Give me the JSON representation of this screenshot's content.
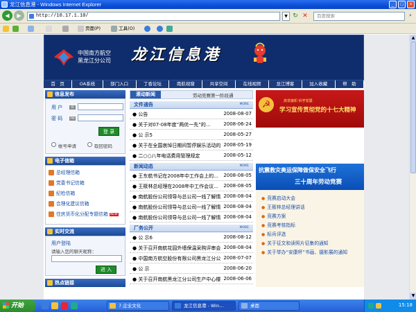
{
  "window": {
    "title": "龙江信息港 - Windows Internet Explorer"
  },
  "browser": {
    "url": "http://10.17.1.10/",
    "search_placeholder": "百度搜索",
    "toolbar": {
      "page_label": "页面(P)",
      "tools_label": "工具(O)"
    }
  },
  "site": {
    "airline_line1": "中国南方航空",
    "airline_line2": "黑龙江分公司",
    "title": "龙江信息港",
    "nav": [
      "首　页",
      "OA系统",
      "部门入口",
      "丁香论坛",
      "南航视窗",
      "共享空间",
      "在线视频",
      "龙江博客",
      "加入收藏",
      "帮　助"
    ],
    "login": {
      "header": "信息发布",
      "user_label": "用 户",
      "password_label": "密 码",
      "login_button": "登 录",
      "apply_label": "帐号申请",
      "retrieve_label": "取回密码"
    },
    "email": {
      "header": "电子信箱",
      "items": [
        "总经理信箱",
        "党委书记信箱",
        "纪检信箱",
        "合理化建议信箱",
        "住房货币化分配专题信箱"
      ],
      "new_badge": "NEW"
    },
    "chat": {
      "header": "实时交流",
      "login_link": "用户登陆",
      "nickname_label": "请输入您的聊天昵称：",
      "enter_button": "进 入"
    },
    "hot_links": {
      "header": "热点链接"
    },
    "scroll_news": {
      "tag": "滚动新闻",
      "text": "劳动竞赛第一阶段通"
    },
    "sections": [
      {
        "title": "文件通告",
        "more": "MORE",
        "items": [
          {
            "title": "公告",
            "date": "2008-08-07"
          },
          {
            "title": "关于对07-08年度“两优一先”的...",
            "date": "2008-06-24"
          },
          {
            "title": "公 示5",
            "date": "2008-05-27"
          },
          {
            "title": "关于在全国哀悼日期间暂停娱乐活动的...",
            "date": "2008-05-19"
          },
          {
            "title": "二○○八年电话费用管理规定",
            "date": "2008-05-12"
          }
        ]
      },
      {
        "title": "新闻动态",
        "more": "MORE",
        "items": [
          {
            "title": "王东航书记在2008年中工作会上的...",
            "date": "2008-08-05"
          },
          {
            "title": "王筱林总经理在2008年中工作会议...",
            "date": "2008-08-05"
          },
          {
            "title": "南航股份公司领导与总公司一线了解情...",
            "date": "2008-08-04"
          },
          {
            "title": "南航股份公司领导与总公司一线了解情...",
            "date": "2008-08-04"
          },
          {
            "title": "南航股份公司领导与总公司一线了解情...",
            "date": "2008-08-04"
          }
        ]
      },
      {
        "title": "厂务公开",
        "more": "MORE",
        "items": [
          {
            "title": "公 示6",
            "date": "2008-08-12"
          },
          {
            "title": "关于召开南航花园外墙保温采购评审会...",
            "date": "2008-08-04"
          },
          {
            "title": "中国南方航空股份有限公司黑龙江分公司...",
            "date": "2008-07-07"
          },
          {
            "title": "公 示",
            "date": "2008-06-20"
          },
          {
            "title": "关于召开南航黑龙江分公司生产中心楼...",
            "date": "2008-06-06"
          }
        ]
      }
    ],
    "right": {
      "red_banner_small": "高举旗帜 科学发展",
      "red_banner_big": "学习宣传贯彻党的十七大精神",
      "blue_banner_line1": "抗震救灾奥运保障做保安全飞行",
      "blue_banner_line2": "三十周年劳动竞赛",
      "items": [
        "竞赛启动大会",
        "王筱林总经理讲话",
        "竞赛方案",
        "竞赛考核指标",
        "标兵评选",
        "关于征文和读照片征集的通知",
        "关于举办“安康杯”书画、摄影展的通知"
      ]
    }
  },
  "taskbar": {
    "start_label": "开始",
    "tasks": [
      "7.企业文化",
      "龙江信息港 - Win...",
      "桌面"
    ],
    "clock": "15:18"
  },
  "colors": {
    "banner_bg": "#0f2d6c",
    "nav_bg": "#1a3a7a",
    "header_blue": "#1d4a98",
    "red_banner": "#c81818",
    "blue_banner": "#1e72d8"
  }
}
